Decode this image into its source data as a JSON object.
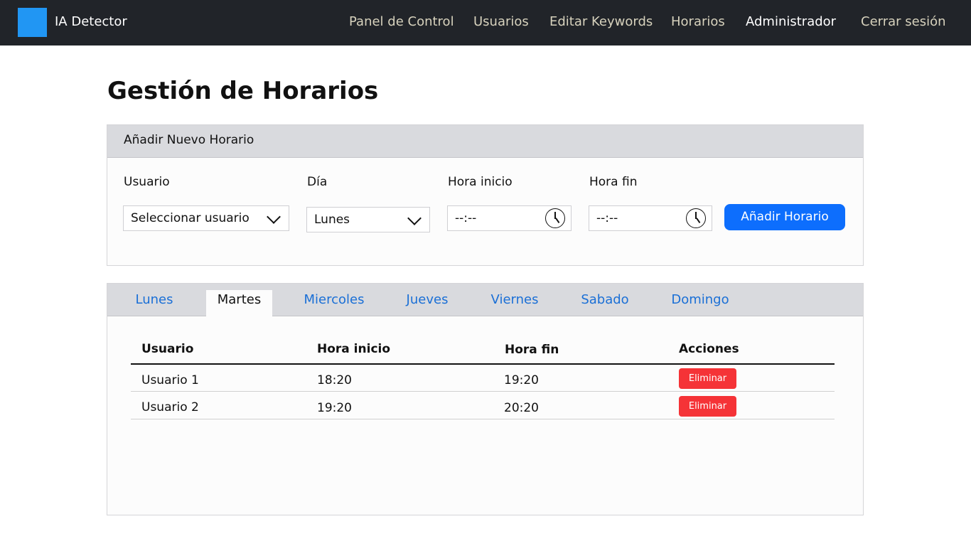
{
  "nav": {
    "brand": "IA Detector",
    "links": [
      "Panel de Control",
      "Usuarios",
      "Editar Keywords",
      "Horarios",
      "Administrador",
      "Cerrar sesión"
    ]
  },
  "title": "Gestión de Horarios",
  "form": {
    "header": "Añadir Nuevo Horario",
    "user_label": "Usuario",
    "user_value": "Seleccionar usuario",
    "day_label": "Día",
    "day_value": "Lunes",
    "start_label": "Hora inicio",
    "start_value": "--:--",
    "end_label": "Hora fin",
    "end_value": "--:--",
    "submit": "Añadir Horario"
  },
  "tabs": [
    "Lunes",
    "Martes",
    "Miercoles",
    "Jueves",
    "Viernes",
    "Sabado",
    "Domingo"
  ],
  "active_tab": "Martes",
  "table": {
    "headers": [
      "Usuario",
      "Hora inicio",
      "Hora fin",
      "Acciones"
    ],
    "rows": [
      {
        "user": "Usuario 1",
        "start": "18:20",
        "end": "19:20",
        "action": "Eliminar"
      },
      {
        "user": "Usuario 2",
        "start": "19:20",
        "end": "20:20",
        "action": "Eliminar"
      }
    ]
  },
  "colors": {
    "accent": "#0d6efd",
    "danger": "#f53337",
    "nav": "#212429",
    "logo": "#2196f3"
  }
}
